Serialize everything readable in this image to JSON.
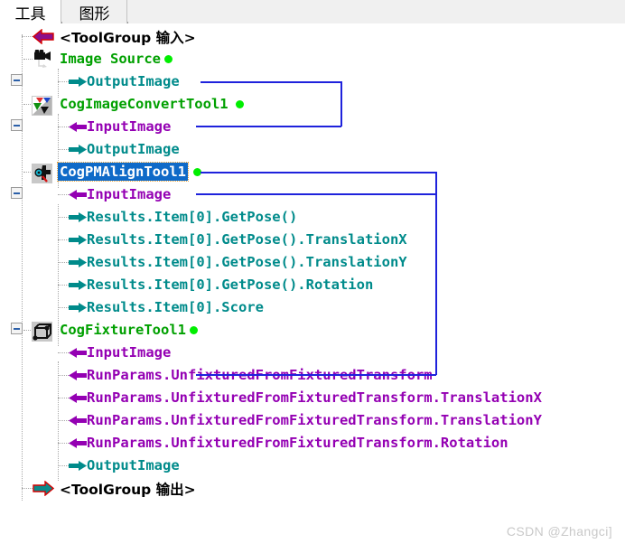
{
  "tabs": [
    {
      "label": "工具",
      "active": true
    },
    {
      "label": "图形",
      "active": false
    }
  ],
  "colors": {
    "tool_green": "#00a000",
    "output_teal": "#008b8b",
    "input_purple": "#9400b3",
    "selection_blue": "#0f6ac8",
    "wire_blue": "#1e22dc",
    "status_dot_green": "#00ee00",
    "group_black": "#000000"
  },
  "tree": {
    "rows": [
      {
        "id": "toolgroup-input",
        "label": "<ToolGroup 输入>",
        "kind": "group",
        "icon": "arrow-left-group-icon",
        "depth": 1,
        "dot": false,
        "selected": false
      },
      {
        "id": "image-source",
        "label": "Image Source",
        "kind": "tool",
        "icon": "camera-icon",
        "depth": 1,
        "dot": true,
        "selected": false,
        "expander": true
      },
      {
        "id": "is-output",
        "label": "OutputImage",
        "kind": "output",
        "icon": "arrow-right-icon",
        "depth": 2,
        "dot": false,
        "selected": false
      },
      {
        "id": "cogimageconverttool1",
        "label": "CogImageConvertTool1",
        "kind": "tool",
        "icon": "image-convert-icon",
        "depth": 1,
        "dot": true,
        "selected": false,
        "expander": true
      },
      {
        "id": "cic-input",
        "label": "InputImage",
        "kind": "input",
        "icon": "arrow-left-icon",
        "depth": 2,
        "dot": false,
        "selected": false
      },
      {
        "id": "cic-output",
        "label": "OutputImage",
        "kind": "output",
        "icon": "arrow-right-icon",
        "depth": 2,
        "dot": false,
        "selected": false
      },
      {
        "id": "cogpmaligntool1",
        "label": "CogPMAlignTool1",
        "kind": "tool",
        "icon": "pmalign-icon",
        "depth": 1,
        "dot": true,
        "selected": true,
        "expander": true
      },
      {
        "id": "pma-input",
        "label": "InputImage",
        "kind": "input",
        "icon": "arrow-left-icon",
        "depth": 2,
        "dot": false,
        "selected": false
      },
      {
        "id": "pma-getpose",
        "label": "Results.Item[0].GetPose()",
        "kind": "output",
        "icon": "arrow-right-icon",
        "depth": 2,
        "dot": false,
        "selected": false
      },
      {
        "id": "pma-tx",
        "label": "Results.Item[0].GetPose().TranslationX",
        "kind": "output",
        "icon": "arrow-right-icon",
        "depth": 2,
        "dot": false,
        "selected": false
      },
      {
        "id": "pma-ty",
        "label": "Results.Item[0].GetPose().TranslationY",
        "kind": "output",
        "icon": "arrow-right-icon",
        "depth": 2,
        "dot": false,
        "selected": false
      },
      {
        "id": "pma-rot",
        "label": "Results.Item[0].GetPose().Rotation",
        "kind": "output",
        "icon": "arrow-right-icon",
        "depth": 2,
        "dot": false,
        "selected": false
      },
      {
        "id": "pma-score",
        "label": "Results.Item[0].Score",
        "kind": "output",
        "icon": "arrow-right-icon",
        "depth": 2,
        "dot": false,
        "selected": false
      },
      {
        "id": "cogfixturetool1",
        "label": "CogFixtureTool1",
        "kind": "tool",
        "icon": "fixture-icon",
        "depth": 1,
        "dot": true,
        "selected": false,
        "expander": true
      },
      {
        "id": "fx-input",
        "label": "InputImage",
        "kind": "input",
        "icon": "arrow-left-icon",
        "depth": 2,
        "dot": false,
        "selected": false
      },
      {
        "id": "fx-unfix",
        "label": "RunParams.UnfixturedFromFixturedTransform",
        "kind": "input",
        "icon": "arrow-left-icon",
        "depth": 2,
        "dot": false,
        "selected": false
      },
      {
        "id": "fx-unfix-tx",
        "label": "RunParams.UnfixturedFromFixturedTransform.TranslationX",
        "kind": "input",
        "icon": "arrow-left-icon",
        "depth": 2,
        "dot": false,
        "selected": false
      },
      {
        "id": "fx-unfix-ty",
        "label": "RunParams.UnfixturedFromFixturedTransform.TranslationY",
        "kind": "input",
        "icon": "arrow-left-icon",
        "depth": 2,
        "dot": false,
        "selected": false
      },
      {
        "id": "fx-unfix-rot",
        "label": "RunParams.UnfixturedFromFixturedTransform.Rotation",
        "kind": "input",
        "icon": "arrow-left-icon",
        "depth": 2,
        "dot": false,
        "selected": false
      },
      {
        "id": "fx-output",
        "label": "OutputImage",
        "kind": "output",
        "icon": "arrow-right-icon",
        "depth": 2,
        "dot": false,
        "selected": false
      },
      {
        "id": "toolgroup-output",
        "label": "<ToolGroup 输出>",
        "kind": "group",
        "icon": "arrow-right-group-icon",
        "depth": 1,
        "dot": false,
        "selected": false
      }
    ]
  },
  "connections": [
    {
      "id": "wire-is-to-cic",
      "from": "is-output",
      "to": "cic-input"
    },
    {
      "id": "wire-cic-to-pma",
      "from": "cic-output",
      "to": "pma-input"
    },
    {
      "id": "wire-cic-to-fx",
      "from": "cic-output",
      "to": "fx-input"
    }
  ],
  "watermark": "CSDN @Zhangci]"
}
